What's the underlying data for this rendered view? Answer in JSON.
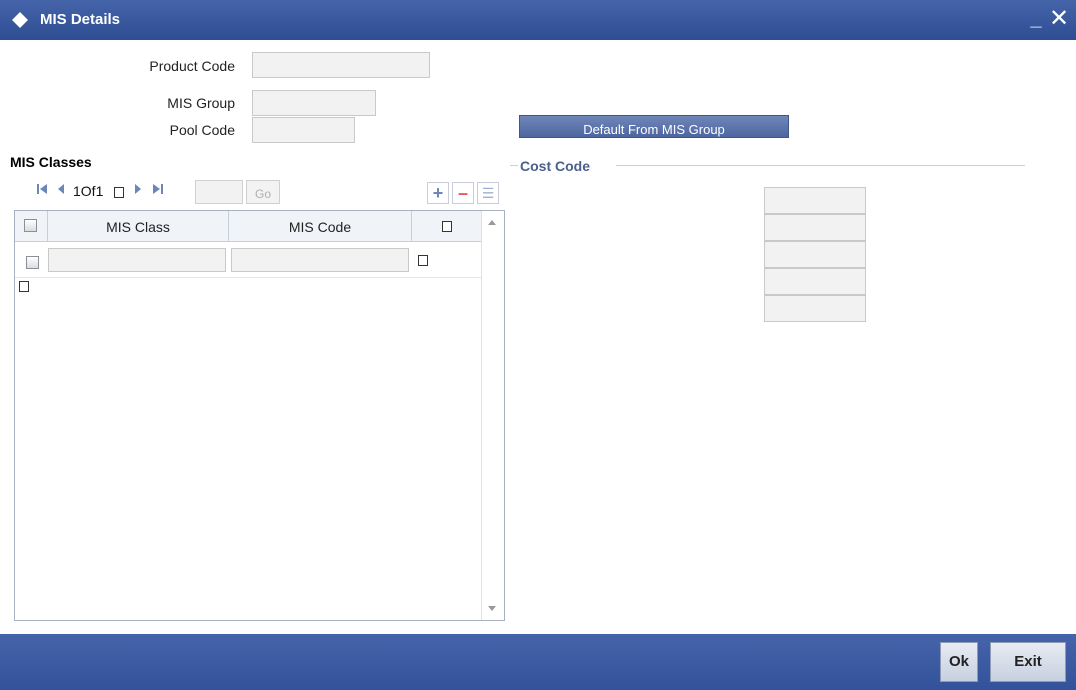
{
  "window": {
    "title": "MIS Details",
    "minimize_label": "_",
    "close_label": "✕",
    "diamond-icon": "diamond-icon"
  },
  "form": {
    "product_code_label": "Product Code",
    "product_code_value": "",
    "mis_group_label": "MIS Group",
    "mis_group_value": "",
    "pool_code_label": "Pool Code",
    "pool_code_value": "",
    "default_button_label": "Default From MIS Group"
  },
  "mis_classes": {
    "section_title": "MIS Classes",
    "pager": {
      "first_icon": "first-page-icon",
      "prev_icon": "prev-page-icon",
      "page_text": "1Of1",
      "next_icon": "next-page-icon",
      "last_icon": "last-page-icon",
      "page_input": "",
      "go_label": "Go"
    },
    "toolbar": {
      "add_label": "+",
      "remove_label": "–",
      "view_label": "☰"
    },
    "columns": [
      "MIS Class",
      "MIS Code"
    ],
    "rows": [
      {
        "mis_class": "",
        "mis_code": ""
      }
    ]
  },
  "cost_code": {
    "legend": "Cost Code",
    "fields": [
      "",
      "",
      "",
      "",
      ""
    ]
  },
  "footer": {
    "ok_label": "Ok",
    "exit_label": "Exit"
  },
  "colors": {
    "titlebar": "#3c5aa0",
    "accent_button": "#5e77ac",
    "legend_text": "#4a5f8c",
    "pager_icons": "#6c86b9"
  }
}
